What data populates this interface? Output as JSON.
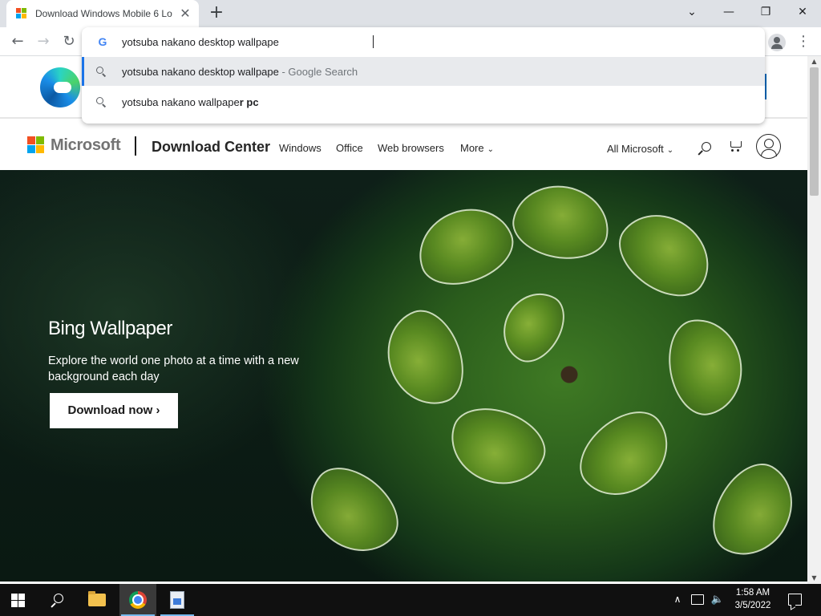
{
  "colors": {
    "accent_blue": "#1a73e8",
    "ms_red": "#f25022",
    "ms_green": "#7fba00",
    "ms_blue": "#00a4ef",
    "ms_yellow": "#ffb900",
    "taskbar": "#101010"
  },
  "browser": {
    "tab": {
      "title": "Download Windows Mobile 6 Lo",
      "favicon": "microsoft-logo-icon",
      "close_glyph": "✕"
    },
    "new_tab_glyph": "+",
    "window_controls": {
      "dropdown": "⌄",
      "minimize": "—",
      "restore": "❐",
      "close": "✕"
    },
    "nav": {
      "back": "←",
      "forward": "→",
      "reload": "↻"
    },
    "menu_glyph": "⋮"
  },
  "omnibox": {
    "provider_glyph": "G",
    "value": "yotsuba nakano desktop wallpape",
    "suggestions": [
      {
        "text": "yotsuba nakano desktop wallpape",
        "suffix": " - Google Search"
      },
      {
        "text": "yotsuba nakano wallpape",
        "bold": "r pc"
      }
    ]
  },
  "ms_header": {
    "brand": "Microsoft",
    "section": "Download Center",
    "nav": [
      "Windows",
      "Office",
      "Web browsers",
      "More"
    ],
    "chevron": "⌄",
    "all_microsoft": "All Microsoft"
  },
  "hero": {
    "title": "Bing Wallpaper",
    "description": "Explore the world one photo at a time with a new background each day",
    "button": "Download now",
    "button_chevron": "›"
  },
  "scrollbar": {
    "up": "▲",
    "down": "▼"
  },
  "taskbar": {
    "time": "1:58 AM",
    "date": "3/5/2022",
    "tray_chevron": "∧",
    "volume_glyph": "🔈"
  }
}
